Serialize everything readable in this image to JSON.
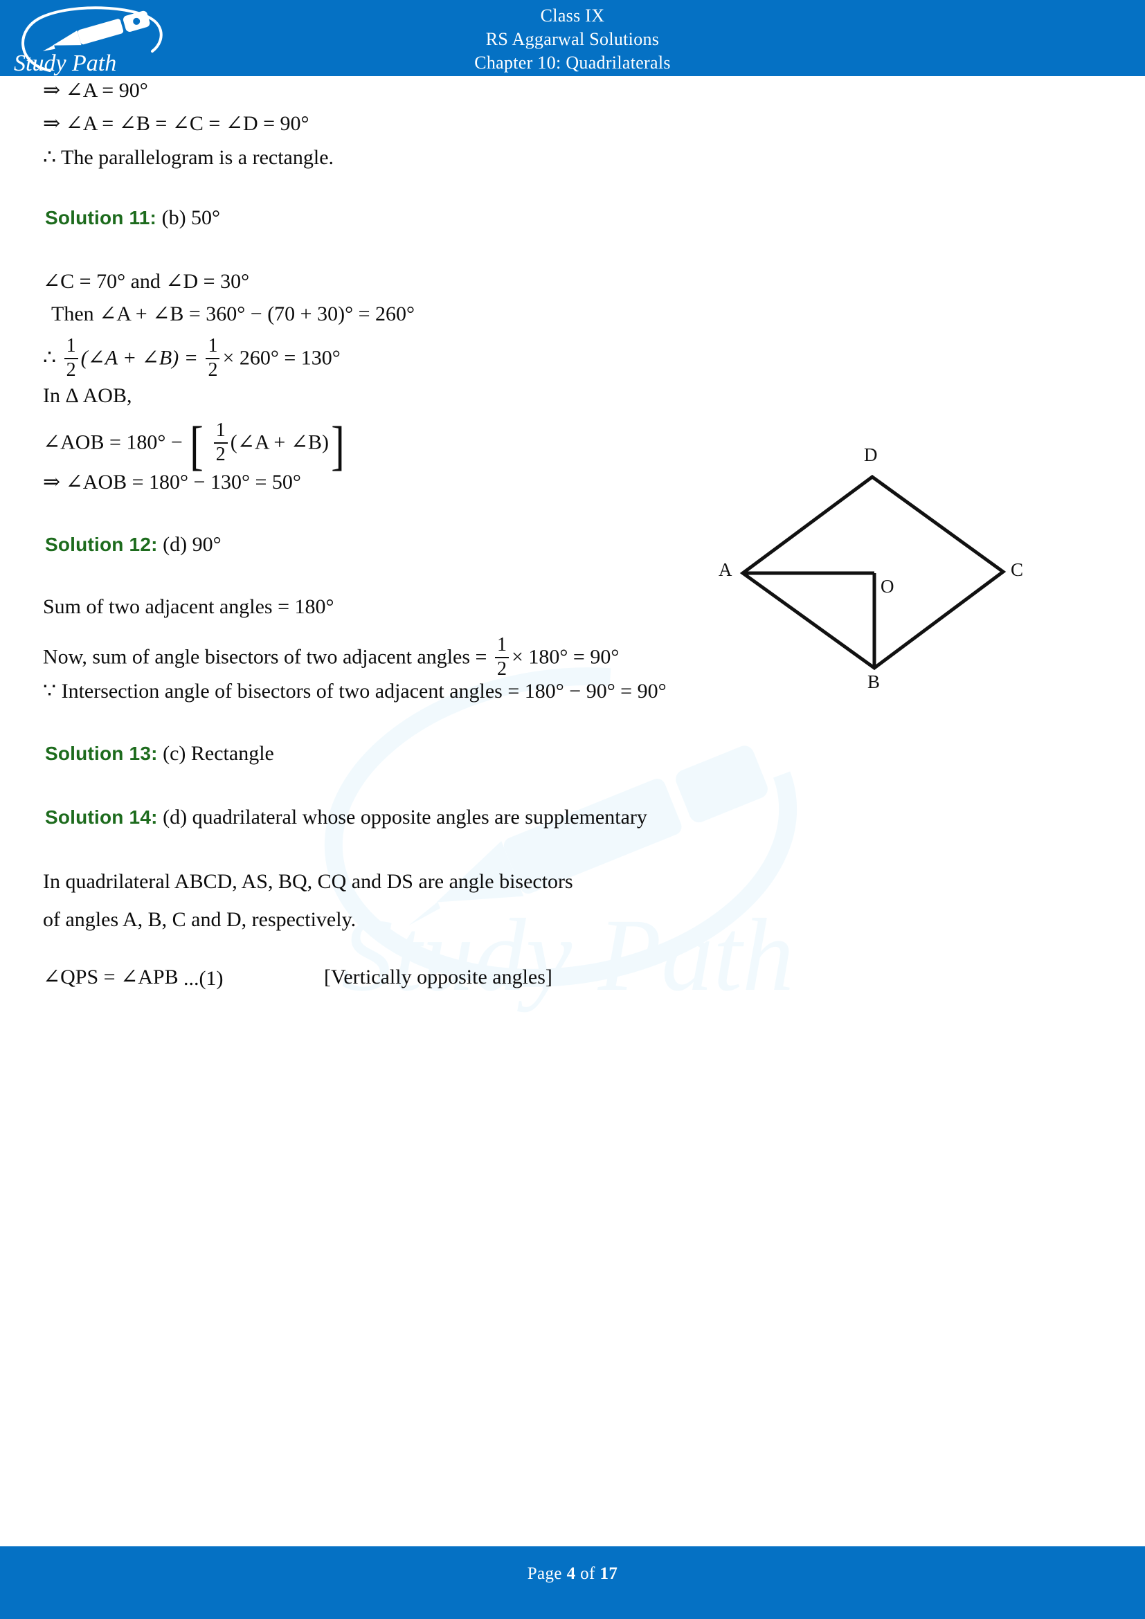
{
  "header": {
    "logo_text": "Study Path",
    "logo_icon": "fountain-pen-oval-logo",
    "line1": "Class IX",
    "line2": "RS Aggarwal Solutions",
    "line3": "Chapter 10: Quadrilaterals",
    "bar_color": "#0571c4",
    "text_color": "#ffffff"
  },
  "footer": {
    "page_prefix": "Page",
    "page_number": "4",
    "page_middle": "of",
    "page_total": "17",
    "bar_color": "#0571c4"
  },
  "watermark": {
    "text": "Study Path",
    "icon": "fountain-pen-oval-logo",
    "color": "#e6f6fd"
  },
  "colors": {
    "solution_label": "#1d6b1d",
    "body_text": "#0d0d0d",
    "brand_blue": "#0571c4"
  },
  "body": {
    "carryover": {
      "line1": "⇒ ∠A = 90°",
      "line2": "⇒ ∠A = ∠B = ∠C = ∠D = 90°",
      "line3": "∴  The parallelogram is a rectangle."
    },
    "solution11": {
      "label": "Solution 11:",
      "answer": "(b) 50°",
      "given": "∠C = 70° and ∠D = 30°",
      "step1": "Then ∠A  +  ∠B  =  360° − (70 + 30)° = 260°",
      "step2_prefix": "∴",
      "step2_num": "1",
      "step2_den": "2",
      "step2_mid": "(∠A + ∠B) =",
      "step2_num2": "1",
      "step2_den2": "2",
      "step2_tail": "× 260° = 130°",
      "step3": "In Δ AOB,",
      "step4_prefix": "∠AOB  = 180° −",
      "step4_bracket_open": "[",
      "step4_num": "1",
      "step4_den": "2",
      "step4_inner": "(∠A  + ∠B)",
      "step4_bracket_close": "]",
      "step5": "⇒ ∠AOB = 180° − 130° = 50°"
    },
    "diagram": {
      "name": "rhombus-ABCD-with-center-O",
      "labels": {
        "D": "D",
        "A": "A",
        "C": "C",
        "B": "B",
        "O": "O"
      }
    },
    "solution12": {
      "label": "Solution 12:",
      "answer": "(d) 90°",
      "step1": "Sum of two adjacent angles = 180°",
      "step2_prefix": "Now, sum of angle bisectors of two adjacent angles  =",
      "step2_num": "1",
      "step2_den": "2",
      "step2_tail": "× 180°  =  90°",
      "step3": "∵ Intersection angle of bisectors of two adjacent angles =  180° − 90° =  90°"
    },
    "solution13": {
      "label": "Solution 13:",
      "answer": "(c) Rectangle"
    },
    "solution14": {
      "label": "Solution 14:",
      "answer": "(d) quadrilateral whose opposite angles are supplementary",
      "line1": "In quadrilateral ABCD, AS, BQ, CQ and DS are angle bisectors",
      "line2": "of angles A, B, C and D, respectively.",
      "eq_left": "∠QPS = ∠APB",
      "eq_ref": "...(1)",
      "eq_note": "[Vertically opposite angles]"
    }
  }
}
